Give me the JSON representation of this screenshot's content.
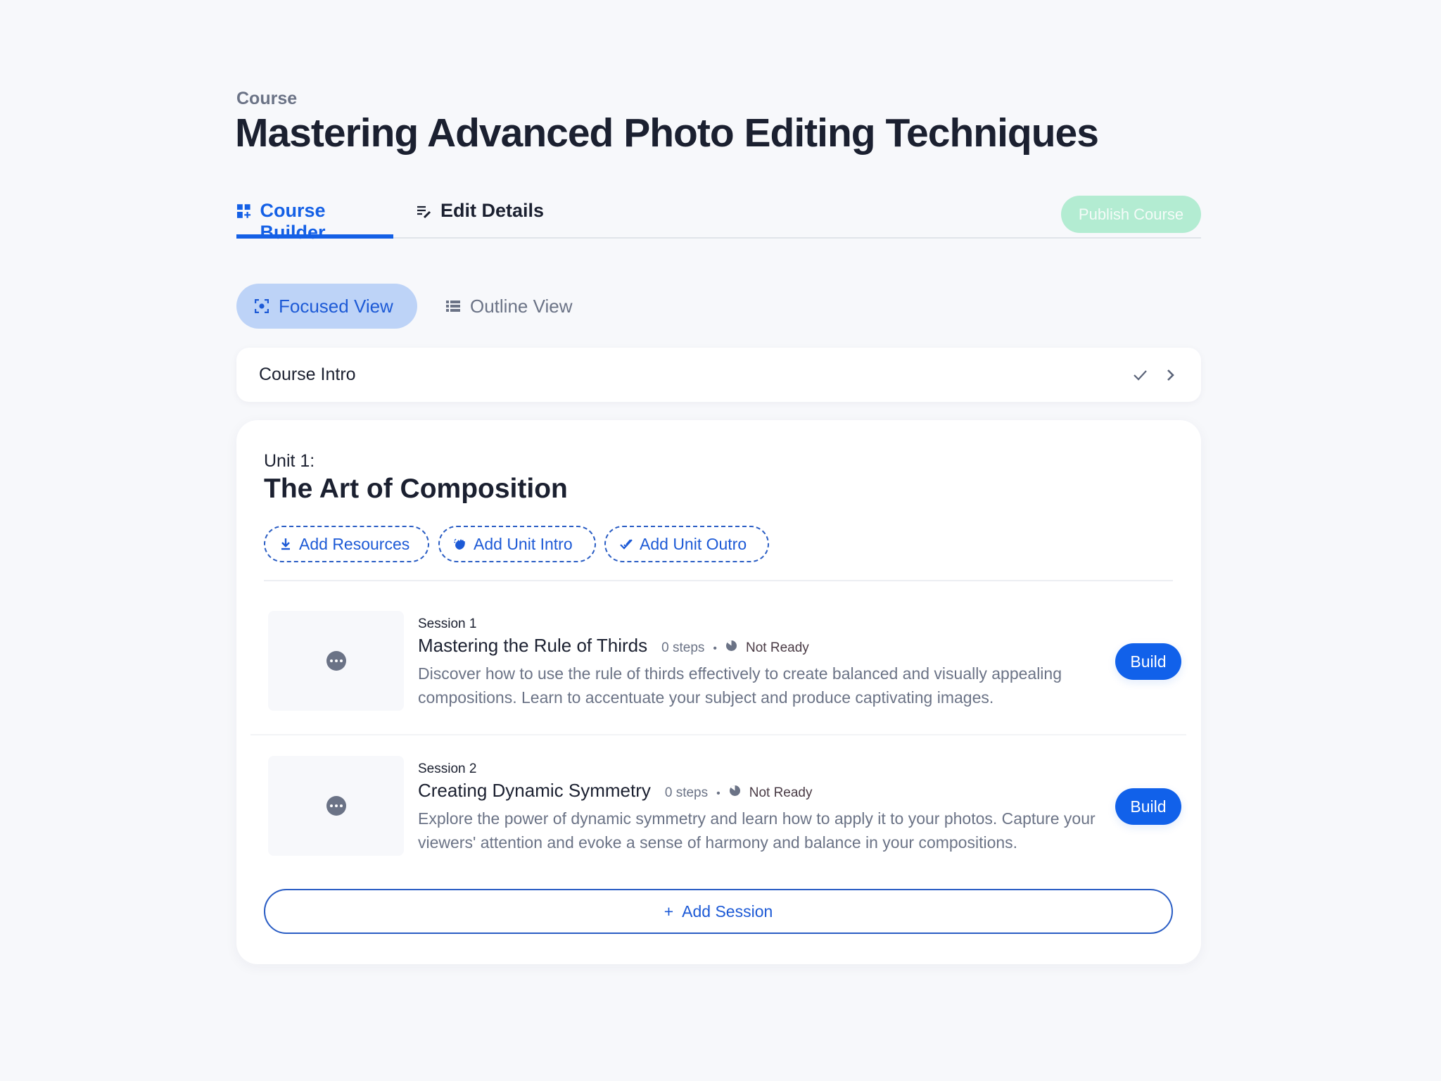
{
  "header": {
    "eyebrow": "Course",
    "title": "Mastering Advanced Photo Editing Techniques"
  },
  "tabs": [
    {
      "label": "Course Builder",
      "icon": "dashboard-add-icon",
      "active": true
    },
    {
      "label": "Edit Details",
      "icon": "edit-notes-icon",
      "active": false
    }
  ],
  "publish": {
    "label": "Publish Course",
    "disabled": true
  },
  "views": [
    {
      "label": "Focused View",
      "icon": "focus-icon",
      "active": true
    },
    {
      "label": "Outline View",
      "icon": "list-icon",
      "active": false
    }
  ],
  "course_intro": {
    "label": "Course Intro",
    "icons": [
      "check-icon",
      "chevron-right-icon"
    ]
  },
  "unit": {
    "label": "Unit 1:",
    "title": "The Art of Composition",
    "actions": [
      {
        "label": "Add Resources",
        "icon": "download-icon"
      },
      {
        "label": "Add Unit Intro",
        "icon": "wave-hand-icon"
      },
      {
        "label": "Add Unit Outro",
        "icon": "double-check-icon"
      }
    ],
    "sessions": [
      {
        "number": "Session 1",
        "title": "Mastering the Rule of Thirds",
        "steps": "0 steps",
        "separator": "•",
        "status": "Not Ready",
        "description": "Discover how to use the rule of thirds effectively to create balanced and visually appealing compositions. Learn to accentuate your subject and produce captivating images.",
        "button": "Build"
      },
      {
        "number": "Session 2",
        "title": "Creating Dynamic Symmetry",
        "steps": "0 steps",
        "separator": "•",
        "status": "Not Ready",
        "description": "Explore the power of dynamic symmetry and learn how to apply it to your photos. Capture your viewers' attention and evoke a sense of harmony and balance in your compositions.",
        "button": "Build"
      }
    ],
    "add_session": {
      "icon": "+",
      "label": "Add Session"
    }
  },
  "colors": {
    "accent": "#1460e6",
    "publish_disabled": "#b3ecd2",
    "focused_pill": "#bdd3f7",
    "muted_text": "#6b7386",
    "background": "#f7f8fb"
  }
}
